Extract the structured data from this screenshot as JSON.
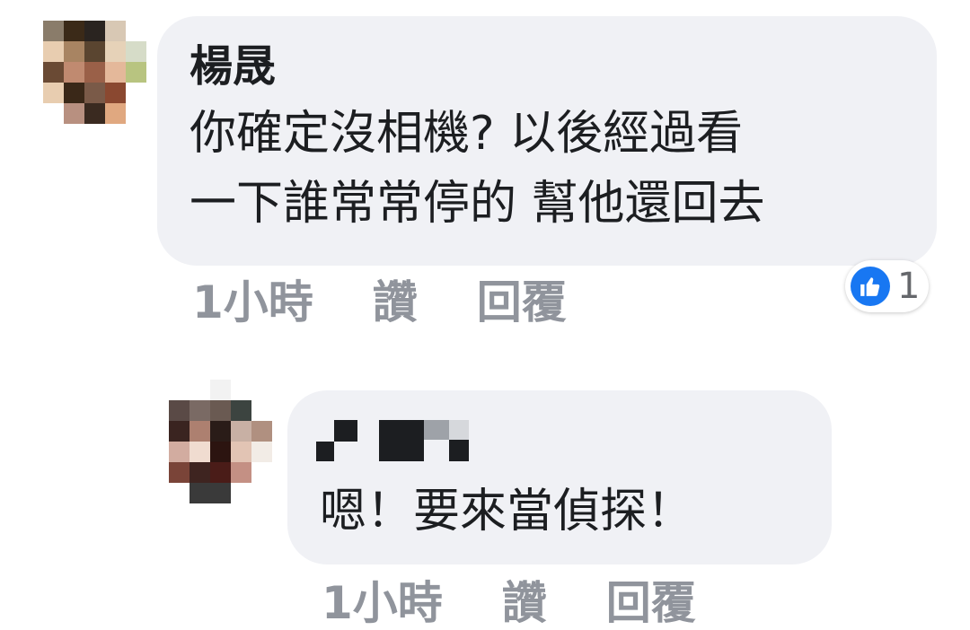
{
  "comments": [
    {
      "author": "楊晟",
      "text": "你確定沒相機? 以後經過看\n一下誰常常停的 幫他還回去",
      "meta": {
        "time": "1小時",
        "like": "讚",
        "reply": "回覆"
      },
      "reaction": {
        "icon": "thumbs-up-icon",
        "count": "1"
      }
    },
    {
      "author_redacted": true,
      "text": "嗯！要來當偵探！",
      "meta": {
        "time": "1小時",
        "like": "讚",
        "reply": "回覆"
      }
    }
  ],
  "colors": {
    "bubble": "#f0f1f5",
    "meta_text": "#90949c",
    "like_blue": "#1877f2",
    "text": "#1c1e21"
  }
}
